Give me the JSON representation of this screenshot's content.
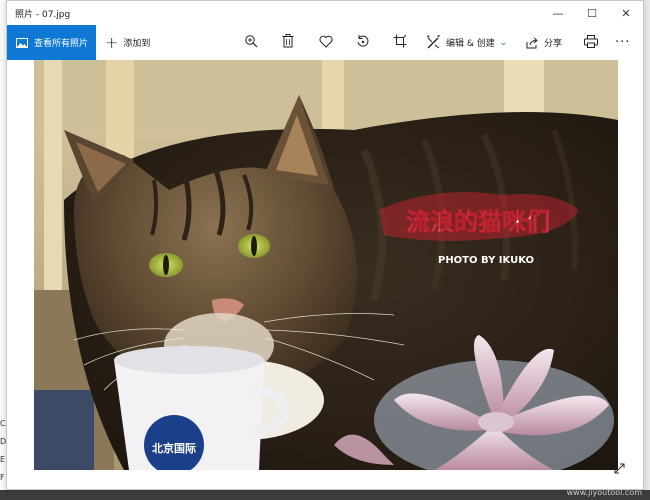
{
  "window": {
    "title": "照片 - 07.jpg",
    "controls": {
      "minimize": "—",
      "maximize": "☐",
      "close": "✕"
    }
  },
  "toolbar": {
    "see_all_label": "查看所有照片",
    "add_to_label": "添加到",
    "edit_create_label": "编辑 & 创建",
    "share_label": "分享",
    "more_label": "···",
    "icons": [
      "zoom-in-icon",
      "delete-icon",
      "heart-icon",
      "rotate-icon",
      "crop-icon",
      "edit-create-icon",
      "share-icon",
      "print-icon"
    ]
  },
  "photo": {
    "overlay_title": "流浪的猫咪们",
    "overlay_credit": "PHOTO BY IKUKO",
    "cup_text": "北京国际"
  },
  "background": {
    "left_letters": [
      "C",
      "D",
      "E",
      "F"
    ],
    "watermark": "www.jiyoutool.com"
  },
  "colors": {
    "accent": "#0f78d4",
    "overlay_red": "#b8222f"
  }
}
